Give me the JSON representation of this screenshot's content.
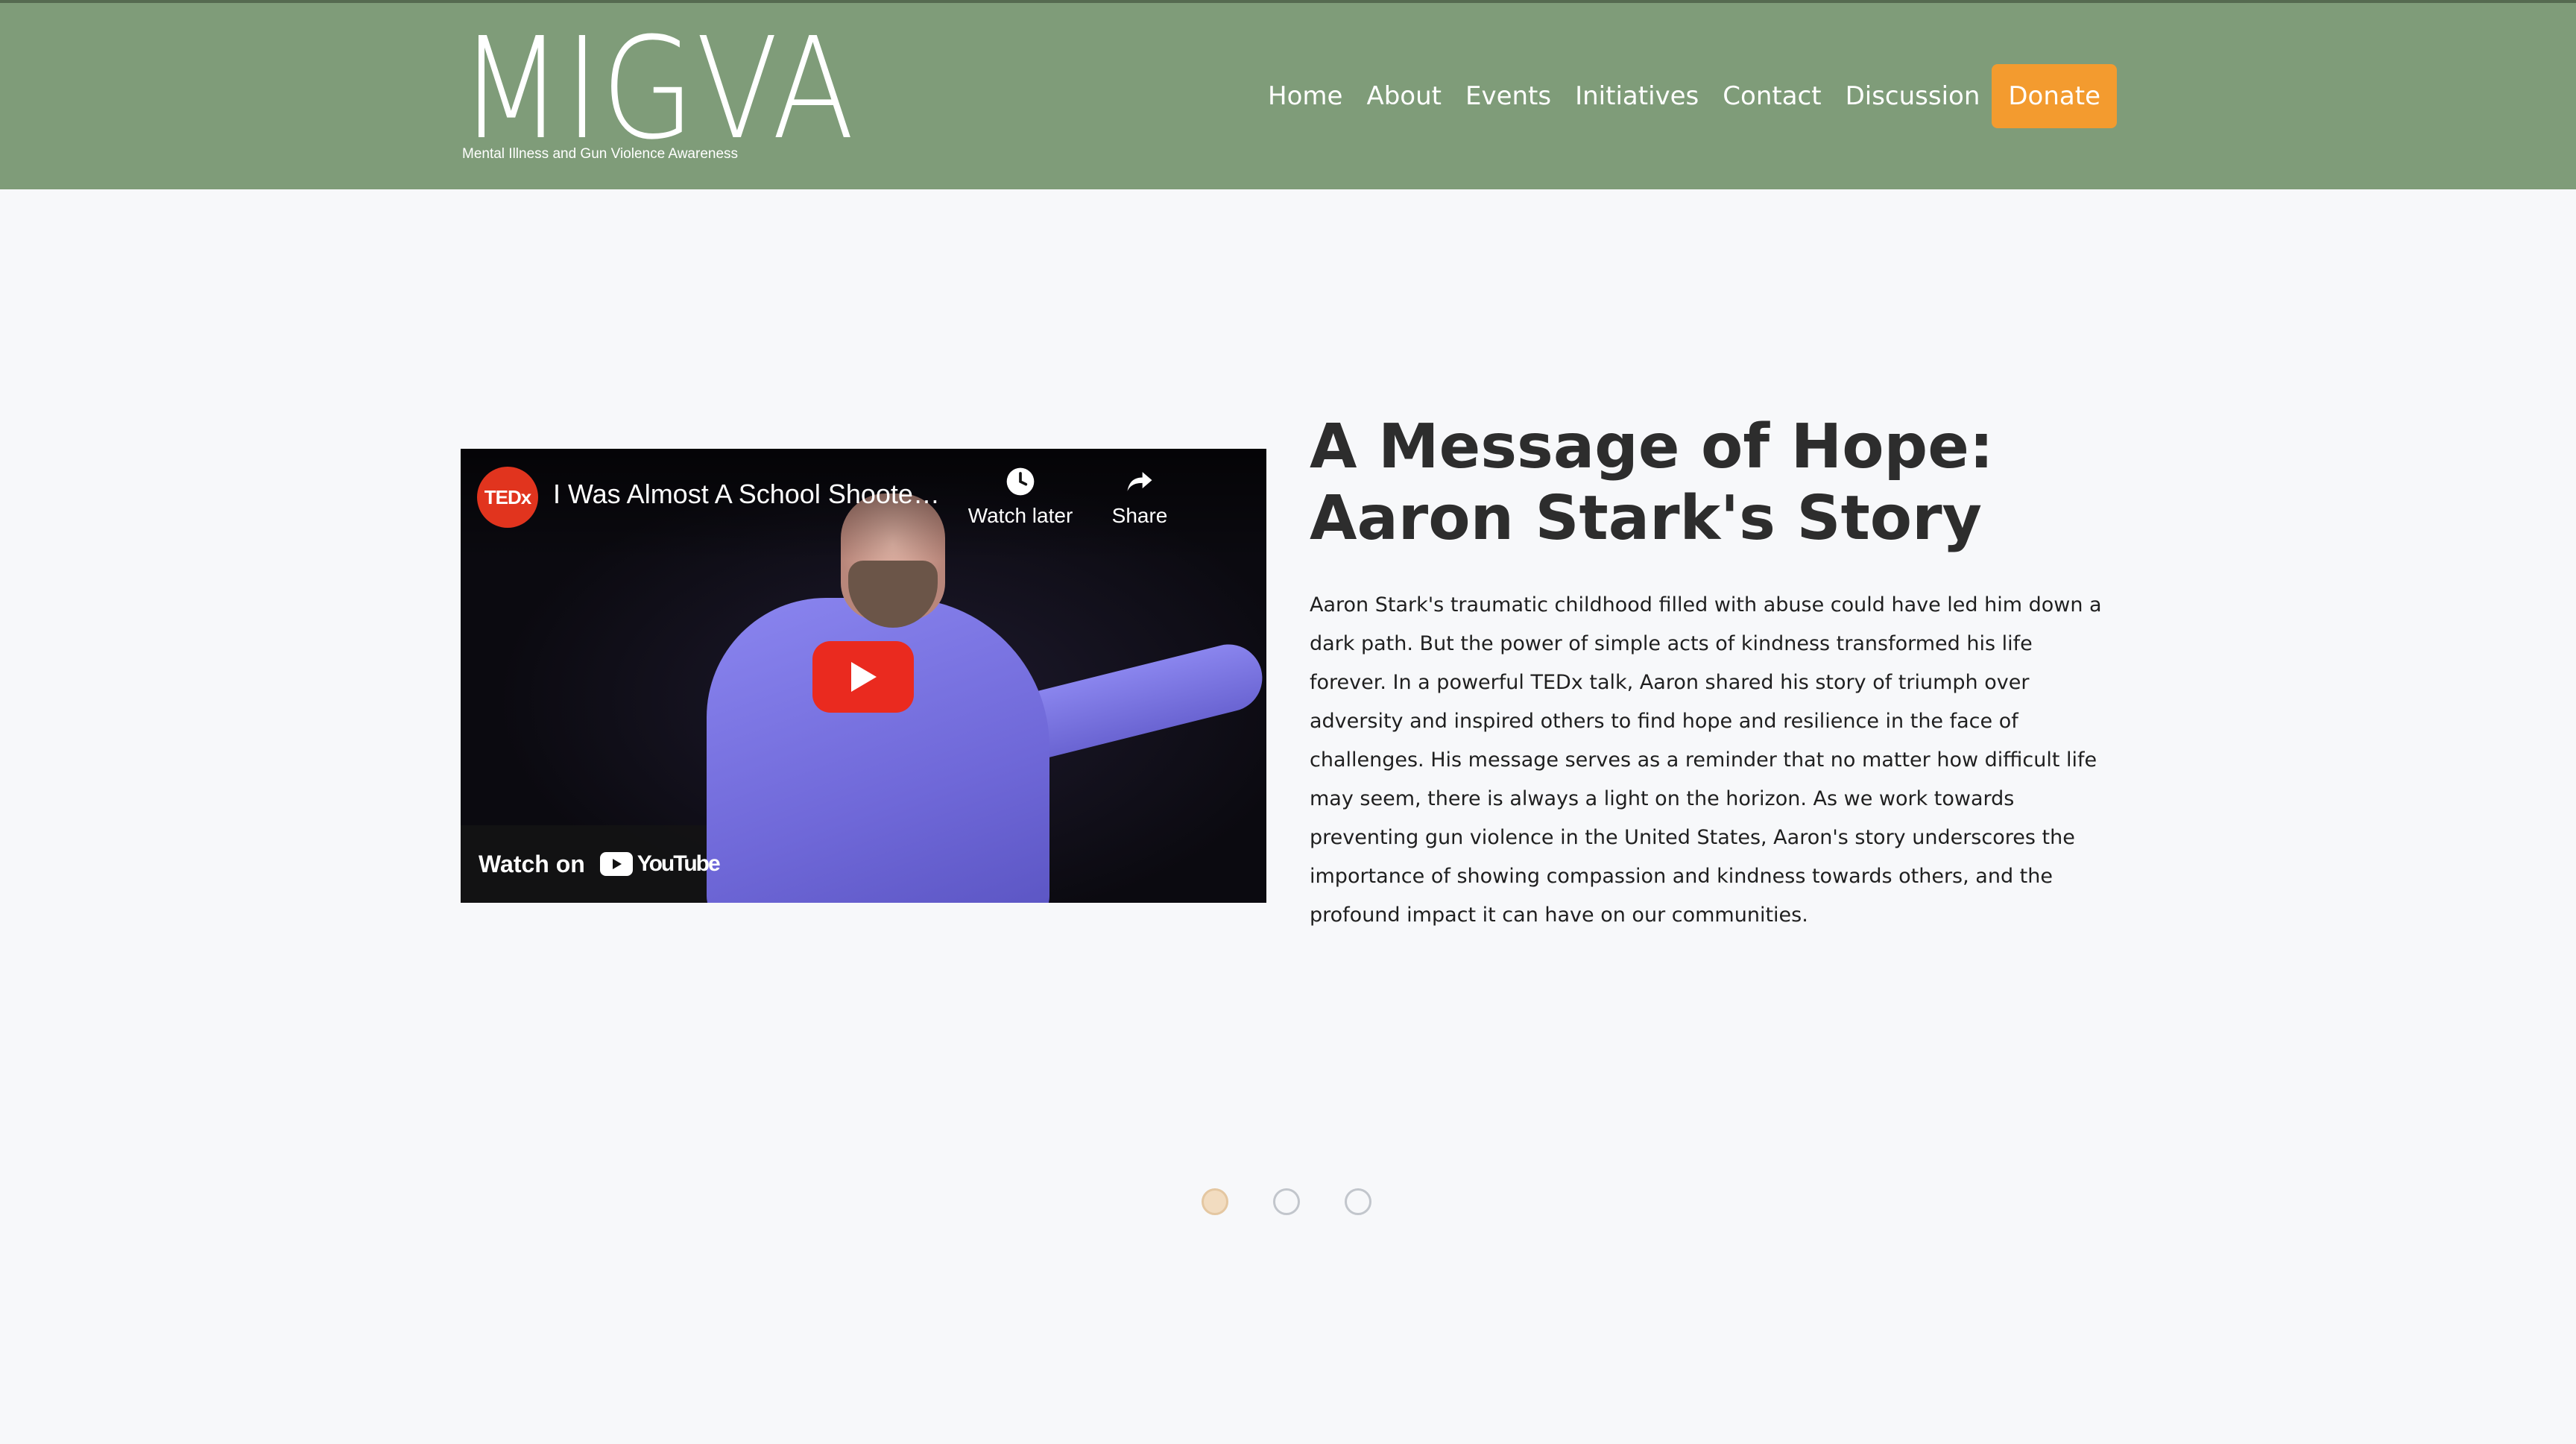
{
  "brand": {
    "logo_text": "MIGVA",
    "tagline": "Mental Illness and Gun Violence Awareness"
  },
  "nav": {
    "items": [
      "Home",
      "About",
      "Events",
      "Initiatives",
      "Contact",
      "Discussion"
    ],
    "donate_label": "Donate"
  },
  "video": {
    "channel_badge": "TEDx",
    "title": "I Was Almost A School Shooter | Aar...",
    "watch_later_label": "Watch later",
    "share_label": "Share",
    "watch_on_label": "Watch on",
    "platform_label": "YouTube"
  },
  "article": {
    "title": "A Message of Hope: Aaron Stark's Story",
    "body": "Aaron Stark's traumatic childhood filled with abuse could have led him down a dark path. But the power of simple acts of kindness transformed his life forever. In a powerful TEDx talk, Aaron shared his story of triumph over adversity and inspired others to find hope and resilience in the face of challenges. His message serves as a reminder that no matter how difficult life may seem, there is always a light on the horizon. As we work towards preventing gun violence in the United States, Aaron's story underscores the importance of showing compassion and kindness towards others, and the profound impact it can have on our communities."
  },
  "carousel": {
    "slide_count": 3,
    "active_index": 0
  },
  "colors": {
    "header_bg": "#7f9c79",
    "donate_bg": "#f39b2f",
    "page_bg": "#f7f8fa",
    "youtube_red": "#ea2a1f"
  }
}
